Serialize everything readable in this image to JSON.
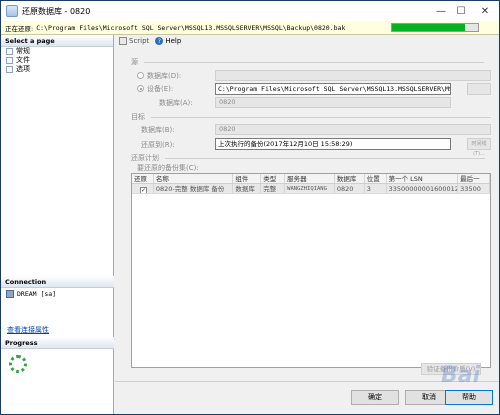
{
  "window": {
    "title": "还原数据库 - 0820",
    "min_glyph": "—",
    "max_glyph": "☐",
    "close_glyph": "✕"
  },
  "status": {
    "label": "正在还原:",
    "path": "C:\\Program Files\\Microsoft SQL Server\\MSSQL13.MSSQLSERVER\\MSSQL\\Backup\\0820.bak",
    "progress": 0.85,
    "progress_color": "#06b025"
  },
  "left": {
    "select_page": "Select a page",
    "pages": [
      {
        "label": "常规"
      },
      {
        "label": "文件"
      },
      {
        "label": "选项"
      }
    ],
    "connection_header": "Connection",
    "connection_item": "DREAM [sa]",
    "view_connection_link": "查看连接属性",
    "progress_header": "Progress"
  },
  "toolbar": {
    "script_label": "Script",
    "help_label": "Help"
  },
  "source": {
    "group_label": "源",
    "database_radio": "数据库(D):",
    "device_radio": "设备(E):",
    "device_path": "C:\\Program Files\\Microsoft SQL Server\\MSSQL13.MSSQLSERVER\\MSSQL\\Backup\\0820.bak",
    "database_label": "数据库(A):",
    "database_value": "0820"
  },
  "destination": {
    "group_label": "目标",
    "database_label": "数据库(B):",
    "database_value": "0820",
    "restore_to_label": "还原到(R):",
    "restore_to_value": "上次执行的备份(2017年12月10日 15:58:29)",
    "timeline_button": "时间线(T)..."
  },
  "restore_plan": {
    "group_label": "还原计划",
    "backup_sets_label": "要还原的备份集(C):",
    "columns": [
      "还原",
      "名称",
      "组件",
      "类型",
      "服务器",
      "数据库",
      "位置",
      "第一个 LSN",
      "最后一"
    ],
    "rows": [
      {
        "checked": "✓",
        "cells": [
          "0820-完整 数据库 备份",
          "数据库",
          "完整",
          "WANGZHIQIANG",
          "0820",
          "3",
          "33500000001600012",
          "33500"
        ]
      }
    ],
    "verify_button": "验证备份介质(V)"
  },
  "footer": {
    "ok": "确定",
    "cancel": "取消",
    "help": "帮助"
  },
  "watermark": "Bai"
}
